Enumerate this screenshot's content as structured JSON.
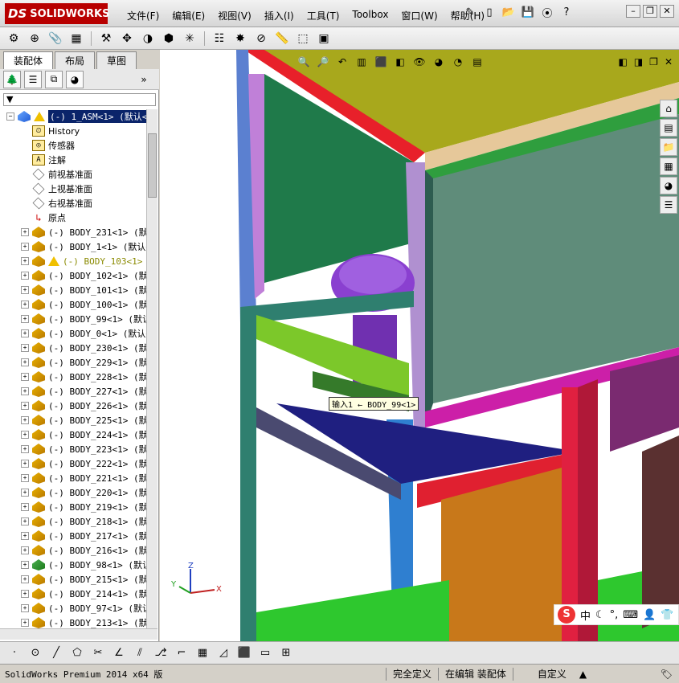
{
  "app": {
    "logo_prefix": "DS",
    "logo_text": "SOLIDWORKS"
  },
  "menu": [
    "文件(F)",
    "编辑(E)",
    "视图(V)",
    "插入(I)",
    "工具(T)",
    "Toolbox",
    "窗口(W)",
    "帮助(H)"
  ],
  "tabs": [
    "装配体",
    "布局",
    "草图"
  ],
  "tree": {
    "root_label": "(-) 1_ASM<1> (默认<默",
    "fixed_items": [
      {
        "label": "History",
        "icon": "history-icon"
      },
      {
        "label": "传感器",
        "icon": "sensor-icon"
      },
      {
        "label": "注解",
        "icon": "annotation-icon"
      },
      {
        "label": "前视基准面",
        "icon": "plane-icon"
      },
      {
        "label": "上视基准面",
        "icon": "plane-icon"
      },
      {
        "label": "右视基准面",
        "icon": "plane-icon"
      },
      {
        "label": "原点",
        "icon": "origin-icon"
      }
    ],
    "bodies": [
      {
        "label": "(-) BODY_231<1> (默认",
        "variant": "normal"
      },
      {
        "label": "(-) BODY_1<1> (默认<",
        "variant": "normal"
      },
      {
        "label": "(-) BODY_103<1> (",
        "variant": "warning"
      },
      {
        "label": "(-) BODY_102<1> (默认",
        "variant": "normal"
      },
      {
        "label": "(-) BODY_101<1> (默认",
        "variant": "normal"
      },
      {
        "label": "(-) BODY_100<1> (默认",
        "variant": "normal"
      },
      {
        "label": "(-) BODY_99<1> (默认",
        "variant": "normal"
      },
      {
        "label": "(-) BODY_0<1> (默认<",
        "variant": "normal"
      },
      {
        "label": "(-) BODY_230<1> (默认",
        "variant": "normal"
      },
      {
        "label": "(-) BODY_229<1> (默认",
        "variant": "normal"
      },
      {
        "label": "(-) BODY_228<1> (默认",
        "variant": "normal"
      },
      {
        "label": "(-) BODY_227<1> (默认",
        "variant": "normal"
      },
      {
        "label": "(-) BODY_226<1> (默认",
        "variant": "normal"
      },
      {
        "label": "(-) BODY_225<1> (默认",
        "variant": "normal"
      },
      {
        "label": "(-) BODY_224<1> (默认",
        "variant": "normal"
      },
      {
        "label": "(-) BODY_223<1> (默认",
        "variant": "normal"
      },
      {
        "label": "(-) BODY_222<1> (默认",
        "variant": "normal"
      },
      {
        "label": "(-) BODY_221<1> (默认",
        "variant": "normal"
      },
      {
        "label": "(-) BODY_220<1> (默认",
        "variant": "normal"
      },
      {
        "label": "(-) BODY_219<1> (默认",
        "variant": "normal"
      },
      {
        "label": "(-) BODY_218<1> (默认",
        "variant": "normal"
      },
      {
        "label": "(-) BODY_217<1> (默认",
        "variant": "normal"
      },
      {
        "label": "(-) BODY_216<1> (默认",
        "variant": "normal"
      },
      {
        "label": "(-) BODY_98<1> (默认",
        "variant": "green"
      },
      {
        "label": "(-) BODY_215<1> (默认",
        "variant": "normal"
      },
      {
        "label": "(-) BODY_214<1> (默认",
        "variant": "normal"
      },
      {
        "label": "(-) BODY_97<1> (默认",
        "variant": "normal"
      },
      {
        "label": "(-) BODY_213<1> (默认",
        "variant": "normal"
      }
    ]
  },
  "viewport": {
    "tooltip": "输入1 ← BODY_99<1>",
    "triad": {
      "x": "X",
      "y": "Y",
      "z": "Z"
    },
    "ime": {
      "lang": "中"
    },
    "colors": {
      "red": "#e8202a",
      "green": "#2e8b57",
      "purple": "#9b30d9",
      "blue": "#4a90d9",
      "yellow": "#b8b820",
      "magenta": "#cc1fa8",
      "orange": "#c8781a",
      "teal": "#2f7f6f"
    }
  },
  "statusbar": {
    "product": "SolidWorks Premium 2014 x64 版",
    "state": "完全定义",
    "mode": "在编辑 装配体",
    "units": "自定义"
  }
}
